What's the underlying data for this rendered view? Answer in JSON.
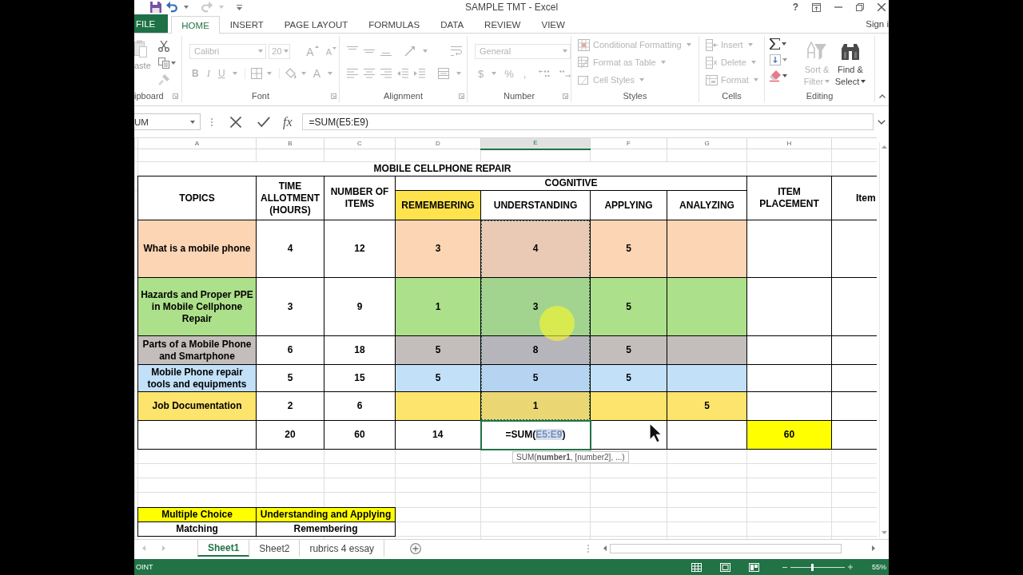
{
  "window": {
    "title": "SAMPLE TMT - Excel",
    "help": "?"
  },
  "ribbon_tabs": [
    {
      "label": "FILE",
      "kind": "file",
      "selected": false
    },
    {
      "label": "HOME",
      "kind": "tab",
      "selected": true
    },
    {
      "label": "INSERT",
      "kind": "tab",
      "selected": false
    },
    {
      "label": "PAGE LAYOUT",
      "kind": "tab",
      "selected": false
    },
    {
      "label": "FORMULAS",
      "kind": "tab",
      "selected": false
    },
    {
      "label": "DATA",
      "kind": "tab",
      "selected": false
    },
    {
      "label": "REVIEW",
      "kind": "tab",
      "selected": false
    },
    {
      "label": "VIEW",
      "kind": "tab",
      "selected": false
    }
  ],
  "account": {
    "label": "Sign i"
  },
  "clipboard": {
    "label": "ipboard",
    "paste": "aste"
  },
  "font": {
    "label": "Font",
    "disabled": true,
    "font_name": "Calibri",
    "font_size": "20",
    "grow": "A",
    "shrink": "A",
    "bold": "B",
    "italic": "I",
    "underline": "U",
    "font_color": "A"
  },
  "alignment": {
    "label": "Alignment",
    "disabled": true
  },
  "number": {
    "label": "Number",
    "disabled": true,
    "format": "General",
    "currency": "$",
    "percent": "%",
    "comma": ","
  },
  "styles": {
    "label": "Styles",
    "commands": [
      {
        "label": "Conditional Formatting",
        "disabled": true
      },
      {
        "label": "Format as Table",
        "disabled": true
      },
      {
        "label": "Cell Styles",
        "disabled": true
      }
    ]
  },
  "cells": {
    "label": "Cells",
    "commands": [
      {
        "label": "Insert",
        "disabled": true
      },
      {
        "label": "Delete",
        "disabled": true
      },
      {
        "label": "Format",
        "disabled": true
      }
    ]
  },
  "editing": {
    "label": "Editing",
    "commands": [
      {
        "label": "Sort & Filter",
        "disabled": true
      },
      {
        "label": "Find & Select",
        "disabled": false
      }
    ]
  },
  "name_box": {
    "value": "UM"
  },
  "formula_bar": {
    "insert_function": "fx",
    "value": "=SUM(E5:E9)"
  },
  "columns": [
    {
      "label": "A",
      "selected": false
    },
    {
      "label": "B",
      "selected": false
    },
    {
      "label": "C",
      "selected": false
    },
    {
      "label": "D",
      "selected": false
    },
    {
      "label": "E",
      "selected": true
    },
    {
      "label": "F",
      "selected": false
    },
    {
      "label": "G",
      "selected": false
    },
    {
      "label": "H",
      "selected": false
    }
  ],
  "sheet": {
    "title": "MOBILE CELLPHONE REPAIR",
    "headers": {
      "topics": "TOPICS",
      "time": "TIME ALLOTMENT (HOURS)",
      "items": "NUMBER OF ITEMS",
      "cognitive": "COGNITIVE",
      "levels": [
        {
          "label": "REMEMBERING",
          "color": "#ffe34d"
        },
        {
          "label": "UNDERSTANDING",
          "color": "#ffffff"
        },
        {
          "label": "APPLYING",
          "color": "#ffffff"
        },
        {
          "label": "ANALYZING",
          "color": "#ffffff"
        }
      ],
      "placement": "ITEM PLACEMENT",
      "column_9": "Item"
    },
    "rows": [
      {
        "topic": "What is a mobile phone",
        "hours": "4",
        "items": "12",
        "remembering": "3",
        "understanding": "4",
        "applying": "5",
        "color": "#fcd5b4",
        "in_sum_range": true
      },
      {
        "topic": "Hazards and Proper PPE in Mobile Cellphone Repair",
        "hours": "3",
        "items": "9",
        "remembering": "1",
        "understanding": "3",
        "applying": "5",
        "color": "#ade08a",
        "in_sum_range": true
      },
      {
        "topic": "Parts of a Mobile Phone and Smartphone",
        "hours": "6",
        "items": "18",
        "remembering": "5",
        "understanding": "8",
        "applying": "5",
        "color": "#c3bebb",
        "in_sum_range": true
      },
      {
        "topic": "Mobile Phone repair tools and equipments",
        "hours": "5",
        "items": "15",
        "remembering": "5",
        "understanding": "5",
        "applying": "5",
        "color": "#c2e0f7",
        "in_sum_range": true
      },
      {
        "topic": "Job Documentation",
        "hours": "2",
        "items": "6",
        "understanding": "1",
        "analyzing": "5",
        "color": "#fde46c",
        "in_sum_range": true
      }
    ],
    "totals": {
      "hours": "20",
      "items": "60",
      "remembering": "14",
      "formula": {
        "before": "=SUM(",
        "reference": "E5:E9",
        "after": ")"
      },
      "placement": "60"
    },
    "tooltip": "SUM(**number1**, [number2], ...)",
    "question_types": [
      {
        "cells": [
          "Multiple Choice",
          "Understanding and Applying"
        ],
        "color": "#ffff00"
      },
      {
        "cells": [
          "Matching",
          "Remembering"
        ],
        "color": "#ffffff"
      }
    ]
  },
  "sheet_tabs": [
    {
      "label": "Sheet1",
      "selected": true
    },
    {
      "label": "Sheet2",
      "selected": false
    },
    {
      "label": "rubrics 4 essay",
      "selected": false
    }
  ],
  "status_bar": {
    "mode": "OINT",
    "zoom": {
      "level": 0.4,
      "reading": "55%"
    }
  }
}
